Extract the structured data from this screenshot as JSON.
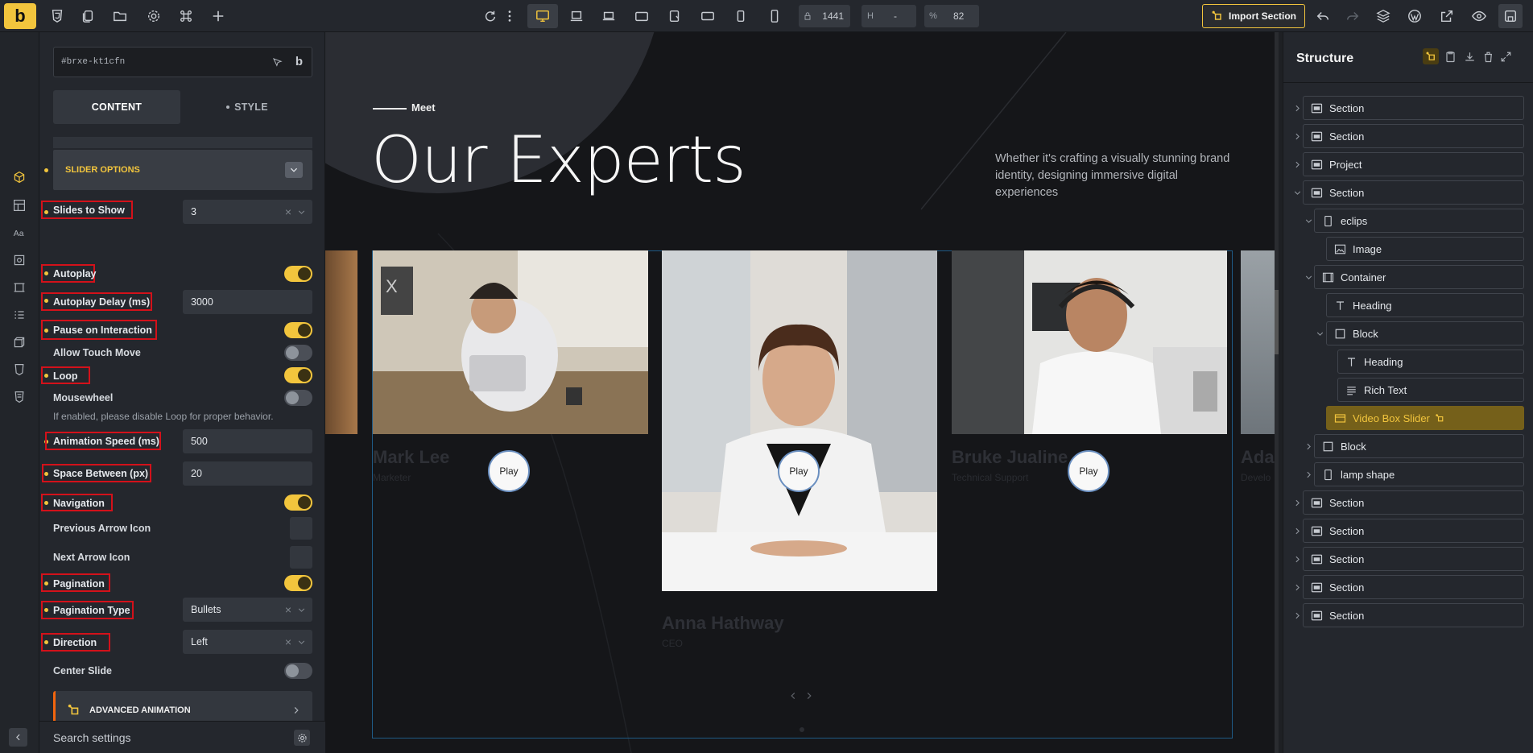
{
  "topbar": {
    "logo": "b",
    "width_label": "1441",
    "height_label": "H",
    "height_value": "-",
    "zoom_label": "%",
    "zoom_value": "82",
    "import_label": "Import Section"
  },
  "panel": {
    "element_id": "#brxe-kt1cfn",
    "tabs": {
      "content": "CONTENT",
      "style": "STYLE"
    },
    "slider_options": "SLIDER OPTIONS",
    "fields": {
      "slides_to_show": {
        "label": "Slides to Show",
        "value": "3"
      },
      "autoplay": {
        "label": "Autoplay",
        "value": true
      },
      "autoplay_delay": {
        "label": "Autoplay Delay (ms)",
        "value": "3000"
      },
      "pause_on_interaction": {
        "label": "Pause on Interaction",
        "value": true
      },
      "allow_touch_move": {
        "label": "Allow Touch Move",
        "value": false
      },
      "loop": {
        "label": "Loop",
        "value": true
      },
      "mousewheel": {
        "label": "Mousewheel",
        "value": false,
        "note": "If enabled, please disable Loop for proper behavior."
      },
      "animation_speed": {
        "label": "Animation Speed (ms)",
        "value": "500"
      },
      "space_between": {
        "label": "Space Between (px)",
        "value": "20"
      },
      "navigation": {
        "label": "Navigation",
        "value": true
      },
      "prev_arrow_icon": {
        "label": "Previous Arrow Icon"
      },
      "next_arrow_icon": {
        "label": "Next Arrow Icon"
      },
      "pagination": {
        "label": "Pagination",
        "value": true
      },
      "pagination_type": {
        "label": "Pagination Type",
        "value": "Bullets"
      },
      "direction": {
        "label": "Direction",
        "value": "Left"
      },
      "center_slide": {
        "label": "Center Slide",
        "value": false
      }
    },
    "advanced_animation": "ADVANCED ANIMATION",
    "search_settings": "Search settings"
  },
  "canvas": {
    "eyebrow": "Meet",
    "title": "Our Experts",
    "description": "Whether it's crafting a visually stunning brand identity, designing immersive digital experiences",
    "play_label": "Play",
    "cards": [
      {
        "name": "Mark Lee",
        "role": "Marketer"
      },
      {
        "name": "Anna Hathway",
        "role": "CEO"
      },
      {
        "name": "Bruke Jualine",
        "role": "Technical Support"
      },
      {
        "name": "Ada",
        "role": "Develo"
      }
    ]
  },
  "structure": {
    "title": "Structure",
    "nodes": [
      {
        "label": "Section",
        "icon": "section-icon"
      },
      {
        "label": "Section",
        "icon": "section-icon"
      },
      {
        "label": "Project",
        "icon": "section-icon"
      },
      {
        "label": "Section",
        "icon": "section-icon"
      },
      {
        "label": "eclips",
        "icon": "div-icon"
      },
      {
        "label": "Image",
        "icon": "image-icon"
      },
      {
        "label": "Container",
        "icon": "container-icon"
      },
      {
        "label": "Heading",
        "icon": "heading-icon"
      },
      {
        "label": "Block",
        "icon": "block-icon"
      },
      {
        "label": "Heading",
        "icon": "heading-icon"
      },
      {
        "label": "Rich Text",
        "icon": "rich-text-icon"
      },
      {
        "label": "Video Box Slider",
        "icon": "video-slider-icon"
      },
      {
        "label": "Block",
        "icon": "block-icon"
      },
      {
        "label": "lamp shape",
        "icon": "div-icon"
      },
      {
        "label": "Section",
        "icon": "section-icon"
      },
      {
        "label": "Section",
        "icon": "section-icon"
      },
      {
        "label": "Section",
        "icon": "section-icon"
      },
      {
        "label": "Section",
        "icon": "section-icon"
      },
      {
        "label": "Section",
        "icon": "section-icon"
      }
    ]
  },
  "colors": {
    "accent": "#f2c53d",
    "highlight_box": "#d3111a",
    "selected_node": "#75601a"
  }
}
